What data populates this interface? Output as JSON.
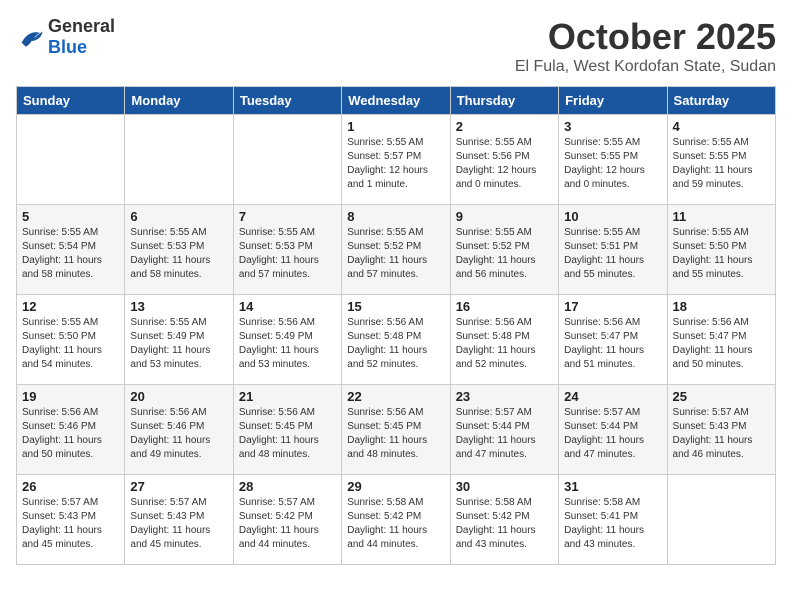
{
  "header": {
    "logo_general": "General",
    "logo_blue": "Blue",
    "month": "October 2025",
    "location": "El Fula, West Kordofan State, Sudan"
  },
  "weekdays": [
    "Sunday",
    "Monday",
    "Tuesday",
    "Wednesday",
    "Thursday",
    "Friday",
    "Saturday"
  ],
  "weeks": [
    [
      {
        "day": "",
        "content": ""
      },
      {
        "day": "",
        "content": ""
      },
      {
        "day": "",
        "content": ""
      },
      {
        "day": "1",
        "content": "Sunrise: 5:55 AM\nSunset: 5:57 PM\nDaylight: 12 hours\nand 1 minute."
      },
      {
        "day": "2",
        "content": "Sunrise: 5:55 AM\nSunset: 5:56 PM\nDaylight: 12 hours\nand 0 minutes."
      },
      {
        "day": "3",
        "content": "Sunrise: 5:55 AM\nSunset: 5:55 PM\nDaylight: 12 hours\nand 0 minutes."
      },
      {
        "day": "4",
        "content": "Sunrise: 5:55 AM\nSunset: 5:55 PM\nDaylight: 11 hours\nand 59 minutes."
      }
    ],
    [
      {
        "day": "5",
        "content": "Sunrise: 5:55 AM\nSunset: 5:54 PM\nDaylight: 11 hours\nand 58 minutes."
      },
      {
        "day": "6",
        "content": "Sunrise: 5:55 AM\nSunset: 5:53 PM\nDaylight: 11 hours\nand 58 minutes."
      },
      {
        "day": "7",
        "content": "Sunrise: 5:55 AM\nSunset: 5:53 PM\nDaylight: 11 hours\nand 57 minutes."
      },
      {
        "day": "8",
        "content": "Sunrise: 5:55 AM\nSunset: 5:52 PM\nDaylight: 11 hours\nand 57 minutes."
      },
      {
        "day": "9",
        "content": "Sunrise: 5:55 AM\nSunset: 5:52 PM\nDaylight: 11 hours\nand 56 minutes."
      },
      {
        "day": "10",
        "content": "Sunrise: 5:55 AM\nSunset: 5:51 PM\nDaylight: 11 hours\nand 55 minutes."
      },
      {
        "day": "11",
        "content": "Sunrise: 5:55 AM\nSunset: 5:50 PM\nDaylight: 11 hours\nand 55 minutes."
      }
    ],
    [
      {
        "day": "12",
        "content": "Sunrise: 5:55 AM\nSunset: 5:50 PM\nDaylight: 11 hours\nand 54 minutes."
      },
      {
        "day": "13",
        "content": "Sunrise: 5:55 AM\nSunset: 5:49 PM\nDaylight: 11 hours\nand 53 minutes."
      },
      {
        "day": "14",
        "content": "Sunrise: 5:56 AM\nSunset: 5:49 PM\nDaylight: 11 hours\nand 53 minutes."
      },
      {
        "day": "15",
        "content": "Sunrise: 5:56 AM\nSunset: 5:48 PM\nDaylight: 11 hours\nand 52 minutes."
      },
      {
        "day": "16",
        "content": "Sunrise: 5:56 AM\nSunset: 5:48 PM\nDaylight: 11 hours\nand 52 minutes."
      },
      {
        "day": "17",
        "content": "Sunrise: 5:56 AM\nSunset: 5:47 PM\nDaylight: 11 hours\nand 51 minutes."
      },
      {
        "day": "18",
        "content": "Sunrise: 5:56 AM\nSunset: 5:47 PM\nDaylight: 11 hours\nand 50 minutes."
      }
    ],
    [
      {
        "day": "19",
        "content": "Sunrise: 5:56 AM\nSunset: 5:46 PM\nDaylight: 11 hours\nand 50 minutes."
      },
      {
        "day": "20",
        "content": "Sunrise: 5:56 AM\nSunset: 5:46 PM\nDaylight: 11 hours\nand 49 minutes."
      },
      {
        "day": "21",
        "content": "Sunrise: 5:56 AM\nSunset: 5:45 PM\nDaylight: 11 hours\nand 48 minutes."
      },
      {
        "day": "22",
        "content": "Sunrise: 5:56 AM\nSunset: 5:45 PM\nDaylight: 11 hours\nand 48 minutes."
      },
      {
        "day": "23",
        "content": "Sunrise: 5:57 AM\nSunset: 5:44 PM\nDaylight: 11 hours\nand 47 minutes."
      },
      {
        "day": "24",
        "content": "Sunrise: 5:57 AM\nSunset: 5:44 PM\nDaylight: 11 hours\nand 47 minutes."
      },
      {
        "day": "25",
        "content": "Sunrise: 5:57 AM\nSunset: 5:43 PM\nDaylight: 11 hours\nand 46 minutes."
      }
    ],
    [
      {
        "day": "26",
        "content": "Sunrise: 5:57 AM\nSunset: 5:43 PM\nDaylight: 11 hours\nand 45 minutes."
      },
      {
        "day": "27",
        "content": "Sunrise: 5:57 AM\nSunset: 5:43 PM\nDaylight: 11 hours\nand 45 minutes."
      },
      {
        "day": "28",
        "content": "Sunrise: 5:57 AM\nSunset: 5:42 PM\nDaylight: 11 hours\nand 44 minutes."
      },
      {
        "day": "29",
        "content": "Sunrise: 5:58 AM\nSunset: 5:42 PM\nDaylight: 11 hours\nand 44 minutes."
      },
      {
        "day": "30",
        "content": "Sunrise: 5:58 AM\nSunset: 5:42 PM\nDaylight: 11 hours\nand 43 minutes."
      },
      {
        "day": "31",
        "content": "Sunrise: 5:58 AM\nSunset: 5:41 PM\nDaylight: 11 hours\nand 43 minutes."
      },
      {
        "day": "",
        "content": ""
      }
    ]
  ]
}
